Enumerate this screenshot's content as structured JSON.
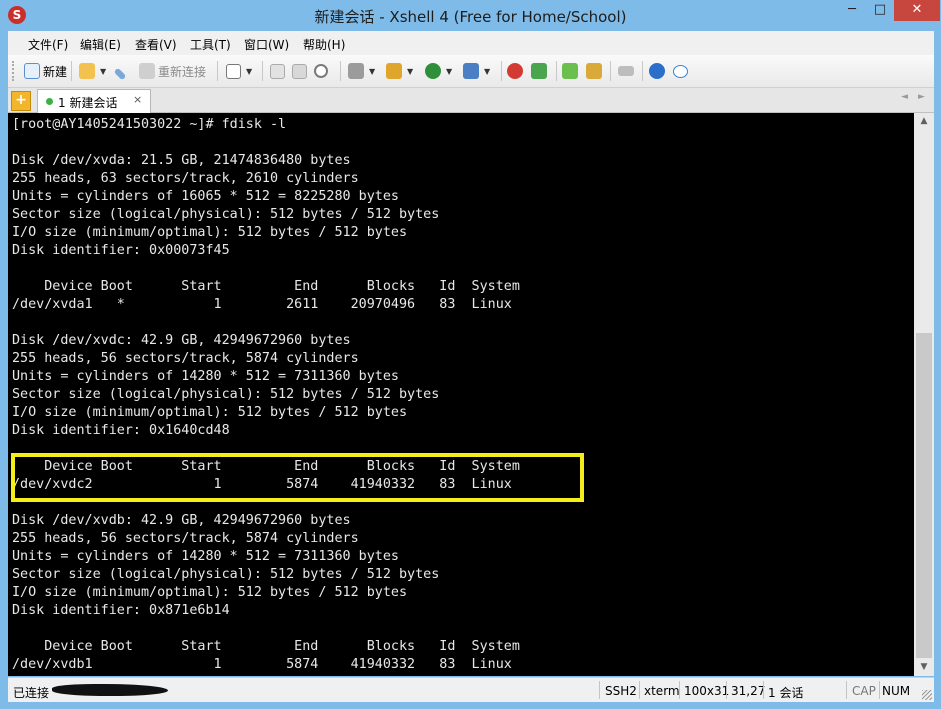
{
  "window": {
    "title": "新建会话 - Xshell 4 (Free for Home/School)",
    "app_icon_glyph": "S",
    "min_glyph": "─",
    "max_glyph": "□",
    "close_glyph": "✕"
  },
  "menu": {
    "items": [
      "文件(F)",
      "编辑(E)",
      "查看(V)",
      "工具(T)",
      "窗口(W)",
      "帮助(H)"
    ]
  },
  "toolbar": {
    "new_label": "新建",
    "reconnect_label": "重新连接",
    "icons": [
      "new-session-icon",
      "open-folder-icon",
      "link-icon",
      "reconnect-icon",
      "properties-icon",
      "copy-icon",
      "paste-icon",
      "find-icon",
      "print-icon",
      "transfer-icon",
      "globe-icon",
      "font-icon",
      "xshell-icon",
      "xftp-icon",
      "layout-icon",
      "lock-icon",
      "keyboard-icon",
      "help-icon",
      "chat-icon"
    ]
  },
  "tabs": {
    "add_glyph": "+",
    "items": [
      {
        "label": "1 新建会话",
        "close_glyph": "×"
      }
    ],
    "nav_left": "◄",
    "nav_right": "►"
  },
  "terminal": {
    "lines": [
      "[root@AY1405241503022 ~]# fdisk -l",
      "",
      "Disk /dev/xvda: 21.5 GB, 21474836480 bytes",
      "255 heads, 63 sectors/track, 2610 cylinders",
      "Units = cylinders of 16065 * 512 = 8225280 bytes",
      "Sector size (logical/physical): 512 bytes / 512 bytes",
      "I/O size (minimum/optimal): 512 bytes / 512 bytes",
      "Disk identifier: 0x00073f45",
      "",
      "    Device Boot      Start         End      Blocks   Id  System",
      "/dev/xvda1   *           1        2611    20970496   83  Linux",
      "",
      "Disk /dev/xvdc: 42.9 GB, 42949672960 bytes",
      "255 heads, 56 sectors/track, 5874 cylinders",
      "Units = cylinders of 14280 * 512 = 7311360 bytes",
      "Sector size (logical/physical): 512 bytes / 512 bytes",
      "I/O size (minimum/optimal): 512 bytes / 512 bytes",
      "Disk identifier: 0x1640cd48",
      "",
      "    Device Boot      Start         End      Blocks   Id  System",
      "/dev/xvdc2               1        5874    41940332   83  Linux",
      "",
      "Disk /dev/xvdb: 42.9 GB, 42949672960 bytes",
      "255 heads, 56 sectors/track, 5874 cylinders",
      "Units = cylinders of 14280 * 512 = 7311360 bytes",
      "Sector size (logical/physical): 512 bytes / 512 bytes",
      "I/O size (minimum/optimal): 512 bytes / 512 bytes",
      "Disk identifier: 0x871e6b14",
      "",
      "    Device Boot      Start         End      Blocks   Id  System",
      "/dev/xvdb1               1        5874    41940332   83  Linux"
    ],
    "highlight_color": "#f5ef18"
  },
  "scrollbar": {
    "up_glyph": "▲",
    "down_glyph": "▼"
  },
  "status": {
    "connection": "已连接",
    "protocol": "SSH2",
    "terminal_type": "xterm",
    "size": "100x31",
    "cursor": "31,27",
    "sessions": "1 会话",
    "caps": "CAP",
    "num": "NUM"
  }
}
